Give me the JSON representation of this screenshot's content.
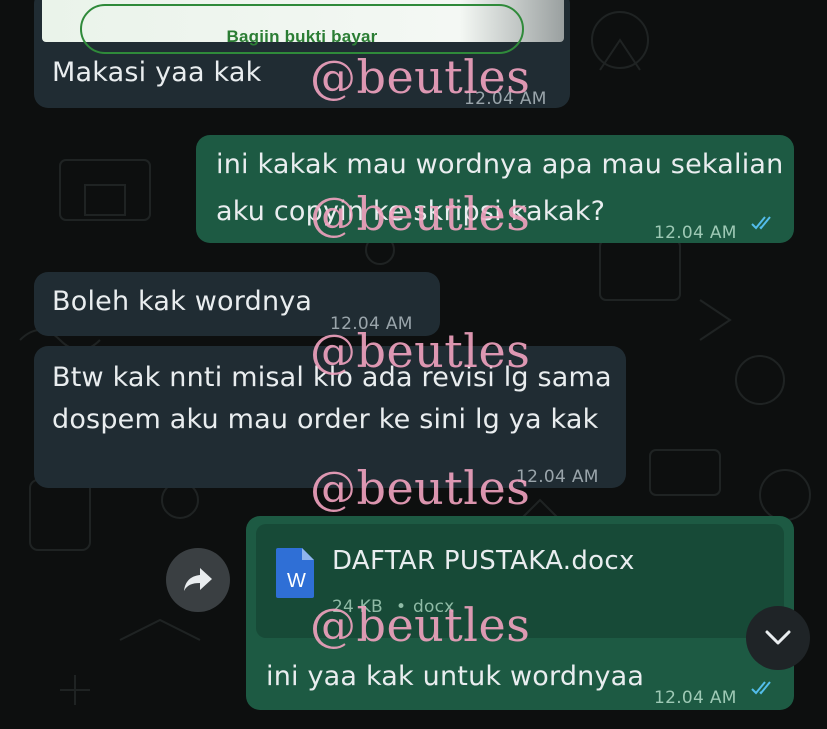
{
  "messages": [
    {
      "id": "m1",
      "direction": "incoming",
      "text": "Makasi yaa kak",
      "time": "12.04 AM",
      "embedded_button": "Bagiin bukti bayar"
    },
    {
      "id": "m2",
      "direction": "outgoing",
      "lines": [
        "ini kakak mau wordnya apa mau sekalian",
        "aku copyin ke skripsi kakak?"
      ],
      "time": "12.04 AM",
      "status": "read"
    },
    {
      "id": "m3",
      "direction": "incoming",
      "text": "Boleh kak wordnya",
      "time": "12.04 AM"
    },
    {
      "id": "m4",
      "direction": "incoming",
      "lines": [
        "Btw kak nnti misal klo ada revisi lg sama",
        "dospem aku mau order ke sini lg ya kak"
      ],
      "time": "12.04 AM"
    },
    {
      "id": "m5",
      "direction": "outgoing",
      "attachment": {
        "file_name": "DAFTAR PUSTAKA.docx",
        "size": "24 KB",
        "separator": "•",
        "type": "docx",
        "icon_letter": "W"
      },
      "text": "ini yaa kak untuk wordnyaa",
      "time": "12.04 AM",
      "status": "read"
    }
  ],
  "watermark": "@beutles",
  "icons": {
    "forward": "forward-arrow-icon",
    "scroll_down": "chevron-down-icon",
    "read_receipt": "double-check-icon",
    "document": "word-document-icon"
  },
  "colors": {
    "background": "#0d0f0f",
    "incoming_bubble": "#202c33",
    "outgoing_bubble": "#1d5a43",
    "read_ticks": "#53bdeb",
    "watermark": "#f2a3c0"
  }
}
